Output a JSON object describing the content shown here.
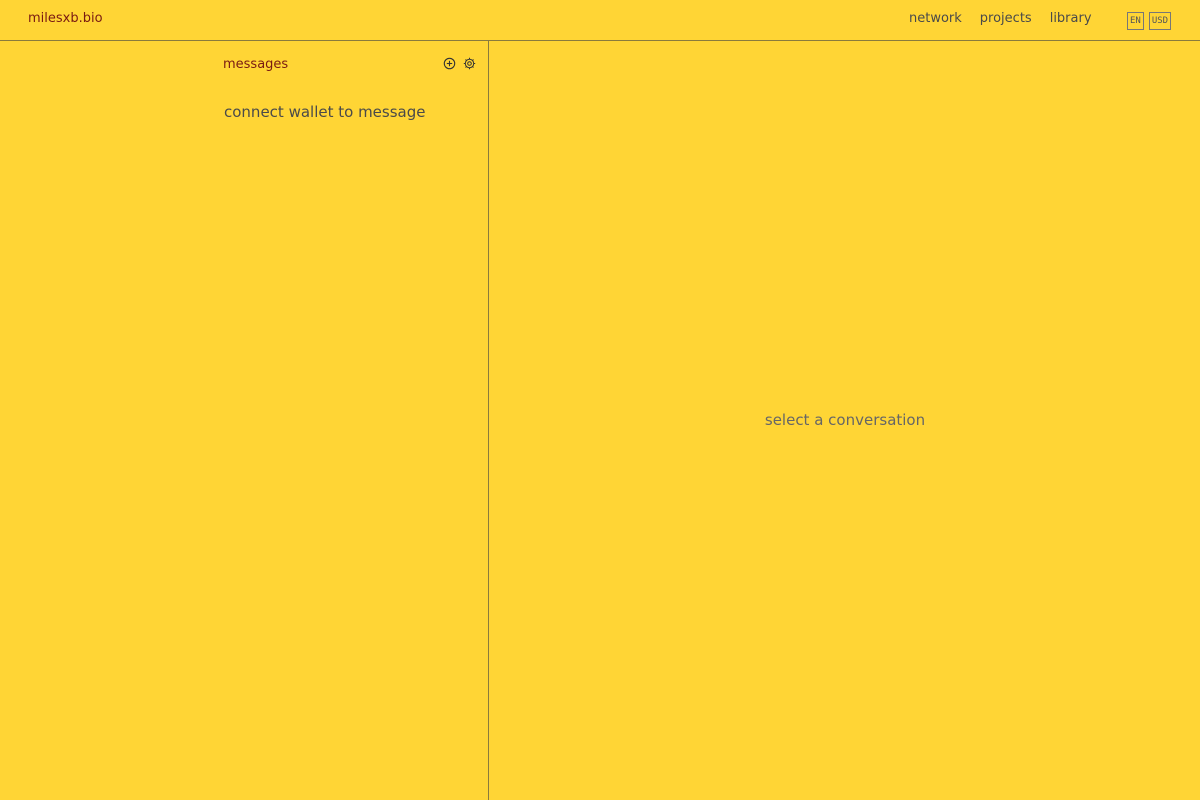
{
  "header": {
    "brand": "milesxb.bio",
    "nav": [
      {
        "label": "network"
      },
      {
        "label": "projects"
      },
      {
        "label": "library"
      }
    ],
    "language": "EN",
    "currency": "USD"
  },
  "sidebar": {
    "title": "messages",
    "icons": [
      "add-circle-icon",
      "gear-icon"
    ],
    "empty_text": "connect wallet to message"
  },
  "main": {
    "placeholder": "select a conversation"
  },
  "colors": {
    "background": "#FFD535",
    "accent": "#7a1a12",
    "text": "#4a4a4a",
    "border": "#8a7b3c"
  }
}
